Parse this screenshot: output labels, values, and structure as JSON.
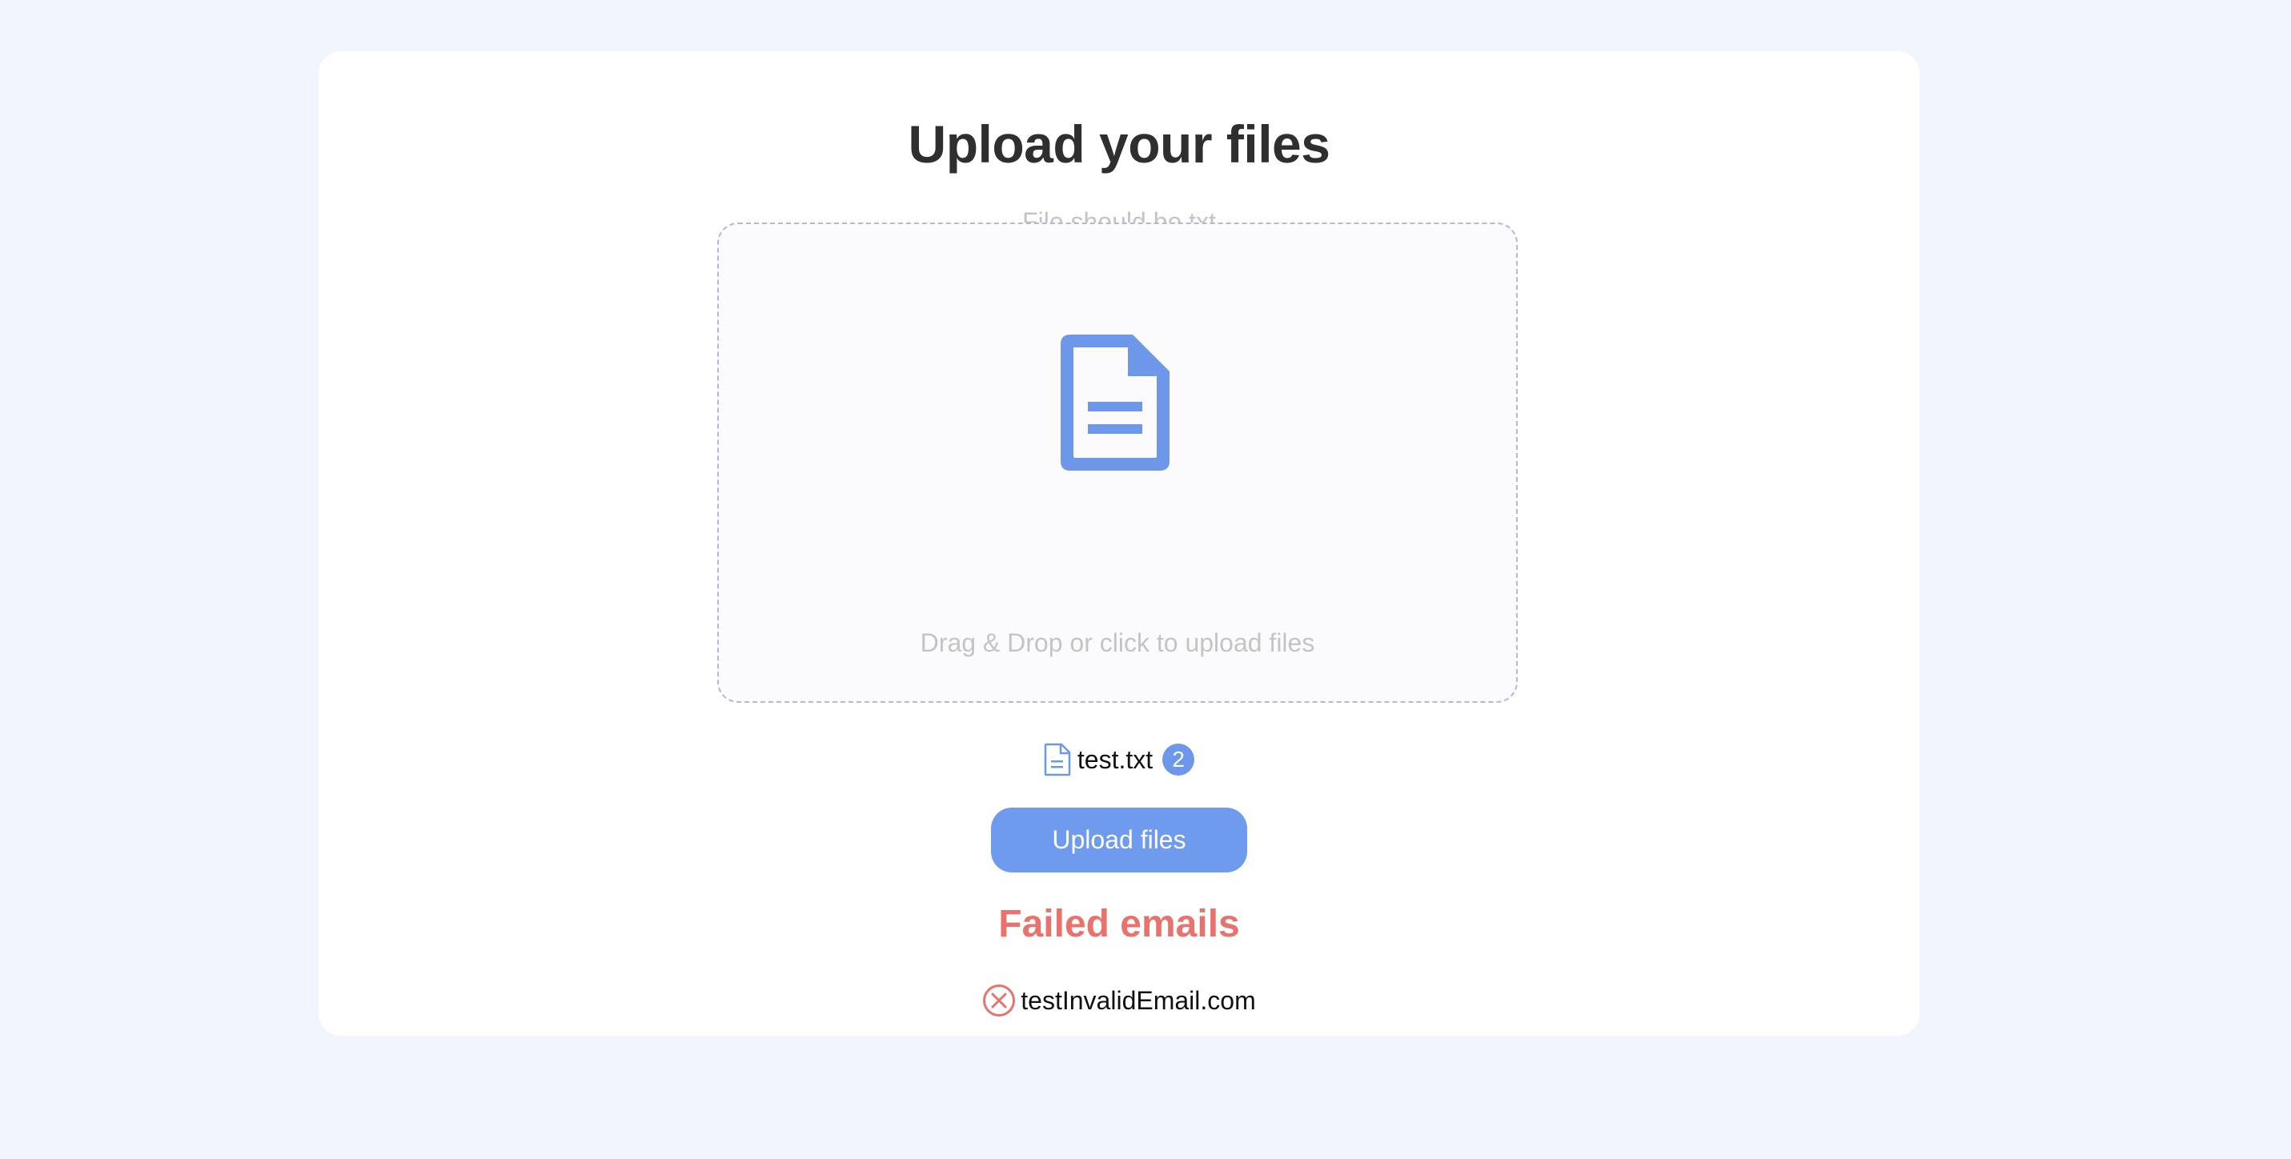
{
  "header": {
    "title": "Upload your files",
    "subtitle": "File should be txt"
  },
  "dropzone": {
    "icon": "document-icon",
    "text": "Drag & Drop or click to upload files"
  },
  "selected_file": {
    "icon": "file-icon",
    "name": "test.txt",
    "count": "2"
  },
  "actions": {
    "upload_label": "Upload files"
  },
  "failed": {
    "title": "Failed emails",
    "items": [
      {
        "icon": "error-circle-icon",
        "email": "testInvalidEmail.com"
      }
    ]
  },
  "colors": {
    "background": "#f1f5fd",
    "card": "#ffffff",
    "accent": "#6e9bed",
    "error": "#e8736d",
    "muted_text": "#c4c4c4",
    "dropzone_border": "#b9b3dd"
  }
}
